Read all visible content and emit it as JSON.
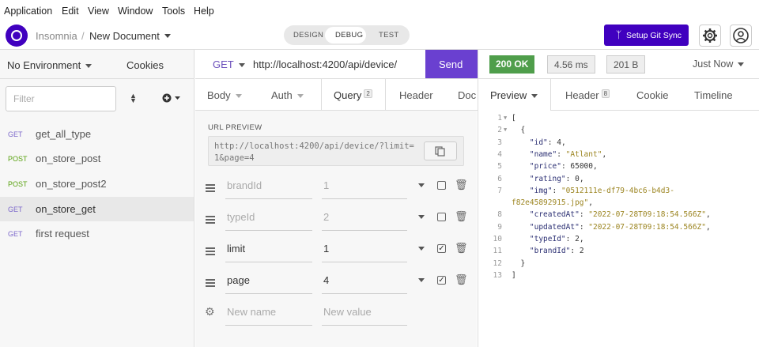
{
  "menu": [
    "Application",
    "Edit",
    "View",
    "Window",
    "Tools",
    "Help"
  ],
  "header": {
    "app_name": "Insomnia",
    "separator": "/",
    "document": "New Document",
    "modes": [
      "DESIGN",
      "DEBUG",
      "TEST"
    ],
    "active_mode": "DEBUG",
    "sync_button": "Setup Git Sync",
    "accent": "#4000bf"
  },
  "sidebar": {
    "environment": "No Environment",
    "cookies": "Cookies",
    "filter_placeholder": "Filter",
    "requests": [
      {
        "method": "GET",
        "name": "get_all_type"
      },
      {
        "method": "POST",
        "name": "on_store_post"
      },
      {
        "method": "POST",
        "name": "on_store_post2"
      },
      {
        "method": "GET",
        "name": "on_store_get"
      },
      {
        "method": "GET",
        "name": "first request"
      }
    ],
    "active_request": "on_store_get"
  },
  "request": {
    "method": "GET",
    "url": "http://localhost:4200/api/device/",
    "send_label": "Send",
    "tabs": {
      "body": "Body",
      "auth": "Auth",
      "query": "Query",
      "query_count": "2",
      "header": "Header",
      "docs": "Doc"
    },
    "active_tab": "Query",
    "url_preview_label": "URL PREVIEW",
    "url_preview": "http://localhost:4200/api/device/?limit=1&page=4",
    "params": [
      {
        "name": "brandId",
        "value": "1",
        "enabled": false
      },
      {
        "name": "typeId",
        "value": "2",
        "enabled": false
      },
      {
        "name": "limit",
        "value": "1",
        "enabled": true
      },
      {
        "name": "page",
        "value": "4",
        "enabled": true
      }
    ],
    "new_name_placeholder": "New name",
    "new_value_placeholder": "New value"
  },
  "response": {
    "status": "200 OK",
    "time": "4.56 ms",
    "size": "201 B",
    "when": "Just Now",
    "status_color": "#4f9e4b",
    "tabs": {
      "preview": "Preview",
      "header": "Header",
      "header_count": "8",
      "cookie": "Cookie",
      "timeline": "Timeline"
    },
    "active_tab": "Preview",
    "line_numbers": [
      "1",
      "2",
      "3",
      "4",
      "5",
      "6",
      "7",
      "",
      "8",
      "9",
      "10",
      "11",
      "12",
      "13"
    ],
    "lines": [
      "[",
      "  {",
      "    \"id\": 4,",
      "    \"name\": \"Atlant\",",
      "    \"price\": 65000,",
      "    \"rating\": 0,",
      "    \"img\": \"0512111e-df79-4bc6-b4d3-",
      "f82e45892915.jpg\",",
      "    \"createdAt\": \"2022-07-28T09:18:54.566Z\",",
      "    \"updatedAt\": \"2022-07-28T09:18:54.566Z\",",
      "    \"typeId\": 2,",
      "    \"brandId\": 2",
      "  }",
      "]"
    ]
  }
}
